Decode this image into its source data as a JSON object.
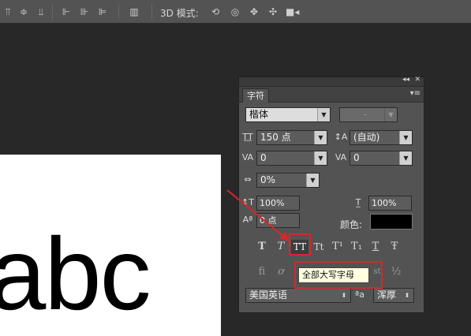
{
  "options_bar": {
    "mode_3d_label": "3D 模式:",
    "align_icons": [
      "align-top-icon",
      "align-vcenter-icon",
      "align-bottom-icon",
      "align-left-icon",
      "align-hcenter-icon",
      "align-right-icon"
    ],
    "distribute_icons": [
      "distribute-icon"
    ],
    "mode_3d_icons": [
      "rotate-3d-icon",
      "roll-3d-icon",
      "pan-3d-icon",
      "slide-3d-icon",
      "scale-3d-icon"
    ]
  },
  "document": {
    "text": "abc"
  },
  "panel": {
    "tab_label": "字符",
    "collapse_glyph": "◂◂",
    "close_glyph": "✕",
    "menu_glyph": "▾≡",
    "font_family": "楷体",
    "font_style": "-",
    "font_size": "150 点",
    "leading": "(自动)",
    "kerning": "0",
    "tracking": "0",
    "scale_ratio": "0%",
    "vertical_scale": "100%",
    "horizontal_scale": "100%",
    "baseline_shift": "0 点",
    "color_label": "颜色:",
    "text_color": "#000000",
    "style_buttons": [
      "T",
      "T",
      "TT",
      "Tt",
      "T¹",
      "T₁",
      "T",
      "Ŧ"
    ],
    "opentype_buttons": [
      "fi",
      "ơ",
      "st",
      "½"
    ],
    "language": "美国英语",
    "aa_icon_text": "ªa",
    "antialias": "浑厚"
  },
  "tooltip": {
    "text": "全部大写字母"
  },
  "highlight_color": "#d9262a"
}
